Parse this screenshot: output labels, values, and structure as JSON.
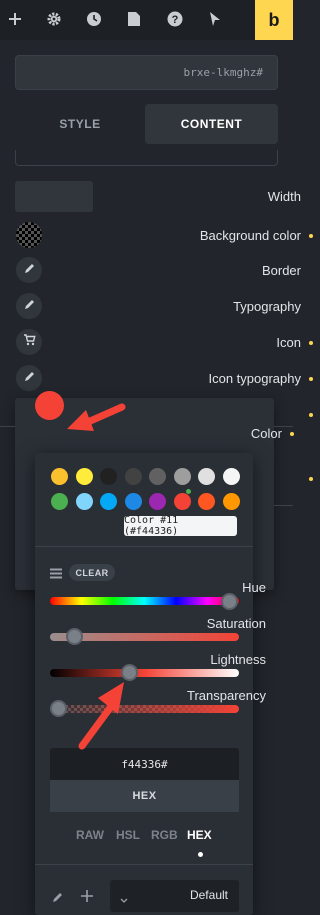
{
  "toolbar": {
    "icons": [
      "plus-icon",
      "gear-icon",
      "clock-icon",
      "page-icon",
      "help-icon",
      "cursor-icon"
    ],
    "brand_letter": "b",
    "brand_color": "#ffd64f"
  },
  "element_id": "brxe-lkmghz#",
  "tabs": {
    "style": "STYLE",
    "content": "CONTENT",
    "active": "content"
  },
  "controls": {
    "width_label": "Width",
    "background_color_label": "Background color",
    "border_label": "Border",
    "typography_label": "Typography",
    "icon_label": "Icon",
    "icon_typography_label": "Icon typography",
    "color_label": "Color"
  },
  "picker": {
    "current_color": "#f44336",
    "swatches_row1": [
      "#fbc02d",
      "#ffeb3b",
      "#212121",
      "#424242",
      "#616161",
      "#9e9e9e",
      "#e0e0e0",
      "#f5f5f5"
    ],
    "swatches_row2": [
      "#4caf50",
      "#81d4fa",
      "#03a9f4",
      "#1e88e5",
      "#9c27b0",
      "#f44336",
      "#ff5722",
      "#ff9800"
    ],
    "tooltip": "Color #11 (#f44336)",
    "clear_label": "CLEAR",
    "sliders": {
      "hue_label": "Hue",
      "saturation_label": "Saturation",
      "lightness_label": "Lightness",
      "transparency_label": "Transparency"
    },
    "hex_value": "f44336#",
    "format_label": "HEX",
    "modes": [
      "RAW",
      "HSL",
      "RGB",
      "HEX"
    ],
    "active_mode": "HEX",
    "preset_label": "Default"
  }
}
